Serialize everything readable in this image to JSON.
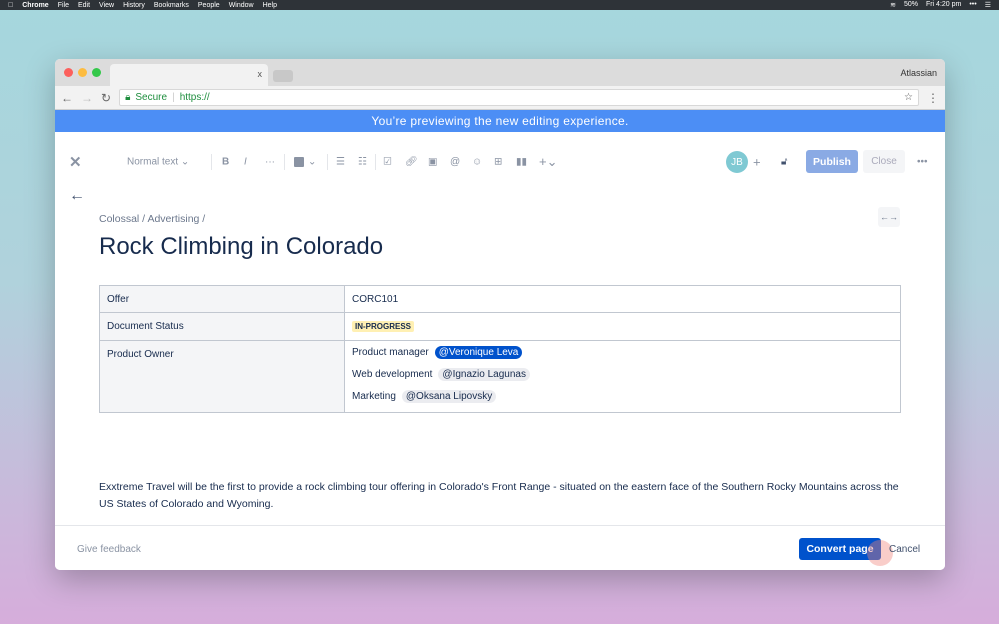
{
  "menubar": {
    "app": "Chrome",
    "items": [
      "File",
      "Edit",
      "View",
      "History",
      "Bookmarks",
      "People",
      "Window",
      "Help"
    ],
    "battery": "50%",
    "clock": "Fri 4:20 pm"
  },
  "browser": {
    "tab_close": "x",
    "profile": "Atlassian",
    "secure": "Secure",
    "url": "https://"
  },
  "banner": "You’re previewing the new editing experience.",
  "toolbar": {
    "text_style": "Normal text",
    "avatar": "JB",
    "publish": "Publish",
    "close": "Close"
  },
  "page": {
    "breadcrumb": "Colossal / Advertising /",
    "title": "Rock Climbing in Colorado",
    "table": {
      "offer_label": "Offer",
      "offer_value": "CORC101",
      "status_label": "Document Status",
      "status_value": "IN-PROGRESS",
      "owner_label": "Product Owner",
      "owners": [
        {
          "role": "Product manager",
          "name": "@Veronique Leva"
        },
        {
          "role": "Web development",
          "name": "@Ignazio Lagunas"
        },
        {
          "role": "Marketing",
          "name": "@Oksana Lipovsky"
        }
      ]
    },
    "paragraph": "Exxtreme Travel will be the first to provide a rock climbing tour offering in Colorado's Front Range - situated on the eastern face of the Southern Rocky Mountains across the US States of Colorado and Wyoming."
  },
  "footer": {
    "feedback": "Give feedback",
    "convert": "Convert page",
    "cancel": "Cancel"
  },
  "colors": {
    "banner": "#4c8ef5",
    "primary": "#0052cc",
    "publish": "#8aaae4",
    "lozenge": "#fff0b3"
  }
}
